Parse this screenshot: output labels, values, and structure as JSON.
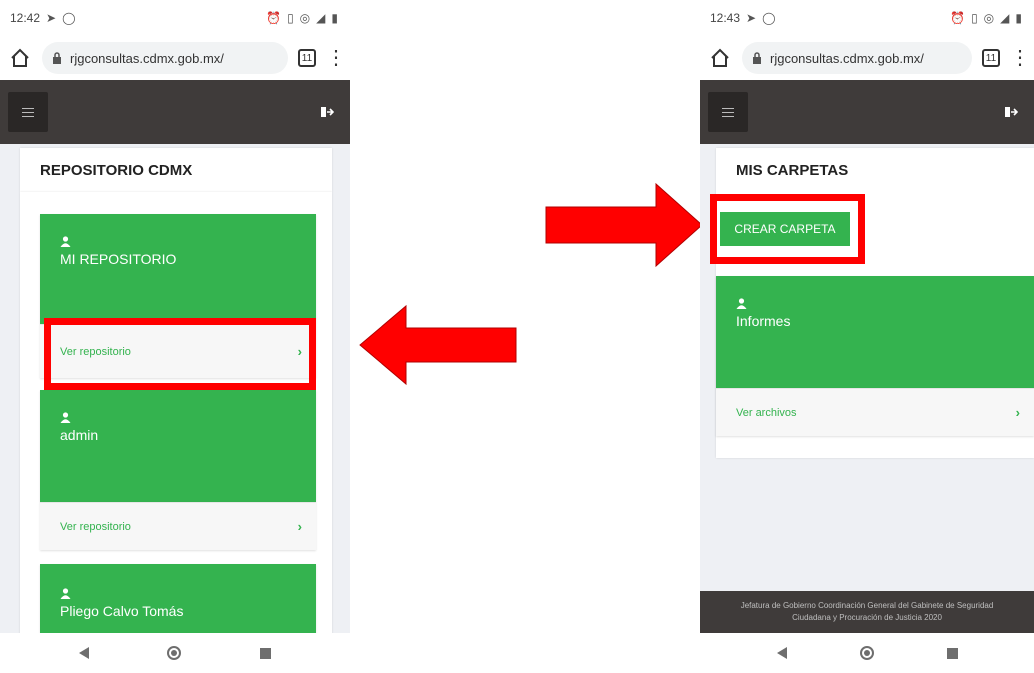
{
  "left_screen": {
    "status": {
      "time": "12:42"
    },
    "browser": {
      "url": "rjgconsultas.cdmx.gob.mx/",
      "tab_count": "11"
    },
    "panel_title": "REPOSITORIO CDMX",
    "cards": [
      {
        "name": "MI REPOSITORIO",
        "link": "Ver repositorio"
      },
      {
        "name": "admin",
        "link": "Ver repositorio"
      },
      {
        "name": "Pliego Calvo Tomás"
      }
    ]
  },
  "right_screen": {
    "status": {
      "time": "12:43"
    },
    "browser": {
      "url": "rjgconsultas.cdmx.gob.mx/",
      "tab_count": "11"
    },
    "panel_title": "MIS CARPETAS",
    "create_button": "CREAR CARPETA",
    "cards": [
      {
        "name": "Informes",
        "link": "Ver archivos"
      }
    ],
    "footer": {
      "line1": "Jefatura de Gobierno Coordinación General del Gabinete de Seguridad",
      "line2": "Ciudadana y Procuración de Justicia 2020"
    }
  },
  "colors": {
    "accent": "#34b34f",
    "highlight": "#ff0000",
    "navbar": "#3f3b3a"
  },
  "icons": [
    "navigation-icon",
    "whatsapp-icon",
    "alarm-icon",
    "vibrate-icon",
    "hotspot-icon",
    "signal-icon",
    "battery-icon",
    "home-icon",
    "lock-icon",
    "tabs-icon",
    "menu-icon",
    "hamburger-icon",
    "logout-icon",
    "user-icon",
    "chevron-right-icon",
    "back-icon",
    "home-circle-icon",
    "recents-icon",
    "red-arrow"
  ]
}
